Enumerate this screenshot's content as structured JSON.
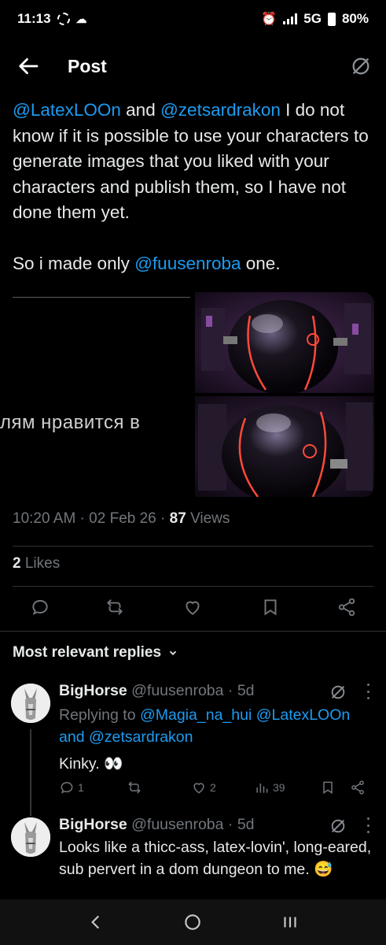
{
  "status": {
    "time": "11:13",
    "network": "5G",
    "battery": "80%"
  },
  "header": {
    "title": "Post"
  },
  "tweet": {
    "mention1": "@LatexLOOn",
    "t1": " and ",
    "mention2": "@zetsardrakon",
    "t2": " I do not know if it is possible to use your characters to generate images that you liked with your characters and publish them, so I have not done them yet.",
    "t3": "So i made only ",
    "mention3": "@fuusenroba",
    "t4": "  one."
  },
  "media": {
    "overlay_text": "лям нравится в"
  },
  "meta": {
    "time": "10:20 AM",
    "date": "02 Feb 26",
    "views": "87",
    "views_label": "Views"
  },
  "likes": {
    "count": "2",
    "label": "Likes"
  },
  "replies_header": "Most relevant replies",
  "replies": [
    {
      "name": "BigHorse",
      "handle": "@fuusenroba",
      "age": "5d",
      "replying_prefix": "Replying to ",
      "replying_to": "@Magia_na_hui @LatexLOOn and @zetsardrakon",
      "text": "Kinky. 👀",
      "reply_count": "1",
      "like_count": "2",
      "view_count": "39"
    },
    {
      "name": "BigHorse",
      "handle": "@fuusenroba",
      "age": "5d",
      "text": "Looks like a thicc-ass, latex-lovin', long-eared, sub pervert in a dom dungeon to me. 😅"
    }
  ],
  "colors": {
    "accent": "#1d9bf0",
    "text": "#e7e9ea",
    "muted": "#71767b",
    "divider": "#2f3336"
  }
}
